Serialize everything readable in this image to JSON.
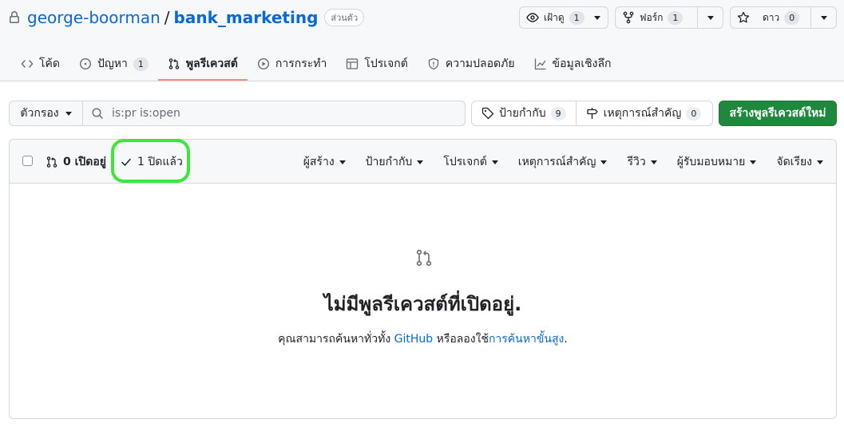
{
  "repo": {
    "owner": "george-boorman",
    "separator": "/",
    "name": "bank_marketing",
    "visibility": "ส่วนตัว"
  },
  "actions": {
    "watch": {
      "label": "เฝ้าดู",
      "count": "1"
    },
    "fork": {
      "label": "ฟอร์ก",
      "count": "1"
    },
    "star": {
      "label": "ดาว",
      "count": "0"
    }
  },
  "tabs": [
    {
      "label": "โค้ด",
      "icon": "code-icon"
    },
    {
      "label": "ปัญหา",
      "count": "1",
      "icon": "issue-opened-icon"
    },
    {
      "label": "พูลรีเควสต์",
      "icon": "git-pull-request-icon",
      "active": true
    },
    {
      "label": "การกระทำ",
      "icon": "play-icon"
    },
    {
      "label": "โปรเจกต์",
      "icon": "table-icon"
    },
    {
      "label": "ความปลอดภัย",
      "icon": "shield-icon"
    },
    {
      "label": "ข้อมูลเชิงลึก",
      "icon": "graph-icon"
    }
  ],
  "filters": {
    "button": "ตัวกรอง",
    "query": "is:pr is:open"
  },
  "labels": {
    "label": "ป้ายกำกับ",
    "count": "9"
  },
  "milestones": {
    "label": "เหตุการณ์สำคัญ",
    "count": "0"
  },
  "new_pr": "สร้างพูลรีเควสต์ใหม่",
  "list": {
    "open": "0 เปิดอยู่",
    "closed": "1 ปิดแล้ว",
    "filters": [
      "ผู้สร้าง",
      "ป้ายกำกับ",
      "โปรเจกต์",
      "เหตุการณ์สำคัญ",
      "รีวิว",
      "ผู้รับมอบหมาย",
      "จัดเรียง"
    ]
  },
  "blank": {
    "title": "ไม่มีพูลรีเควสต์ที่เปิดอยู่.",
    "text_before": "คุณสามารถค้นหาทั่วทั้ง ",
    "github_link": "GitHub",
    "text_middle": " หรือลองใช้",
    "advanced_link": "การค้นหาขั้นสูง",
    "text_after": "."
  },
  "colors": {
    "accent": "#0969da",
    "primary_button": "#1f883d",
    "active_tab": "#fd8c73",
    "highlight": "#3ee63a"
  }
}
